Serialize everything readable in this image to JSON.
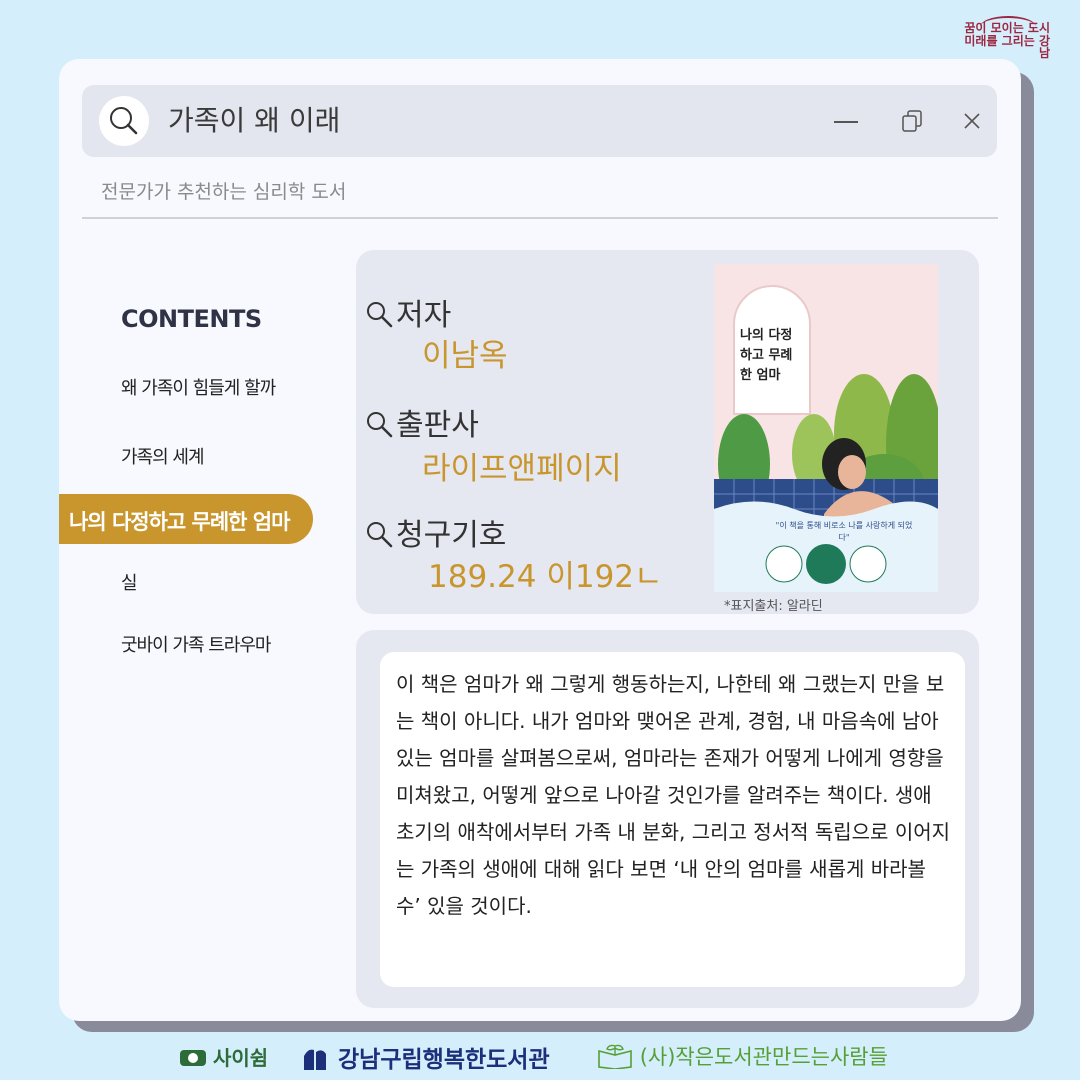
{
  "brand": {
    "line1": "꿈이 모이는 도시",
    "line2": "미래를 그리는 강남"
  },
  "search": {
    "query": "가족이 왜 이래"
  },
  "subtitle": "전문가가 추천하는 심리학 도서",
  "contents": {
    "title": "CONTENTS",
    "items": [
      "왜 가족이 힘들게 할까",
      "가족의 세계",
      "나의 다정하고 무례한 엄마",
      "실",
      "굿바이 가족 트라우마"
    ],
    "active_index": 2
  },
  "book": {
    "author_label": "저자",
    "author": "이남옥",
    "publisher_label": "출판사",
    "publisher": "라이프앤페이지",
    "call_label": "청구기호",
    "call_number": "189.24 이192ㄴ",
    "cover_title": "나의 다정하고 무례한 엄마",
    "cover_quote": "\"이 책을 통해 비로소 나를 사랑하게 되었다\"",
    "cover_credit": "*표지출처: 알라딘"
  },
  "description": "이 책은 엄마가 왜 그렇게 행동하는지, 나한테 왜 그랬는지 만을 보는 책이 아니다. 내가 엄마와 맺어온 관계, 경험, 내 마음속에 남아있는 엄마를 살펴봄으로써, 엄마라는 존재가 어떻게 나에게 영향을 미쳐왔고, 어떻게 앞으로 나아갈 것인가를 알려주는 책이다. 생애 초기의 애착에서부터 가족 내 분화, 그리고 정서적 독립으로 이어지는 가족의 생애에 대해 읽다 보면 ‘내 안의 엄마를 새롭게 바라볼 수’ 있을 것이다.",
  "footer": {
    "org1": "사이쉼",
    "org2": "강남구립행복한도서관",
    "org3": "(사)작은도서관만드는사람들"
  },
  "colors": {
    "accent": "#c8962c",
    "background": "#d5eefb",
    "panel": "#e5e7f1"
  }
}
